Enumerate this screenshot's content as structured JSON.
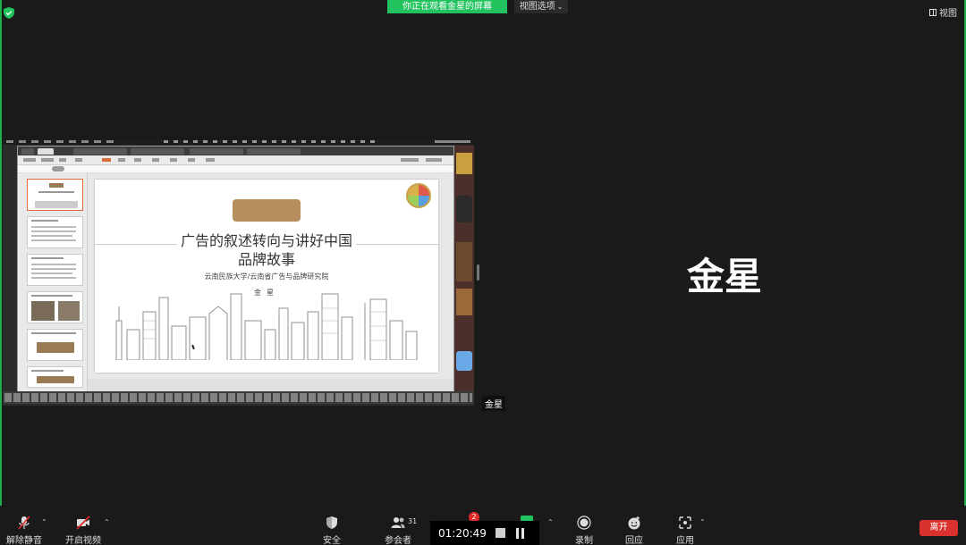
{
  "header": {
    "viewing_banner": "你正在观看金星的屏幕",
    "view_options": "视图选项",
    "view_button": "视图"
  },
  "shared_screen": {
    "sharer_label": "金星",
    "slide": {
      "title_line1": "广告的叙述转向与讲好中国",
      "title_line2": "品牌故事",
      "subtitle": "云南民族大学/云南省广告与品牌研究院",
      "author": "金星"
    }
  },
  "participant": {
    "name": "金星"
  },
  "toolbar": {
    "unmute": "解除静音",
    "start_video": "开启视频",
    "security": "安全",
    "participants": "参会者",
    "participants_count": "31",
    "chat_badge": "2",
    "record": "录制",
    "reactions": "回应",
    "apps": "应用",
    "leave": "离开"
  },
  "recording": {
    "elapsed": "01:20:49"
  },
  "colors": {
    "accent_green": "#22c35e",
    "leave_red": "#d9322e",
    "badge_red": "#e02a2a"
  }
}
